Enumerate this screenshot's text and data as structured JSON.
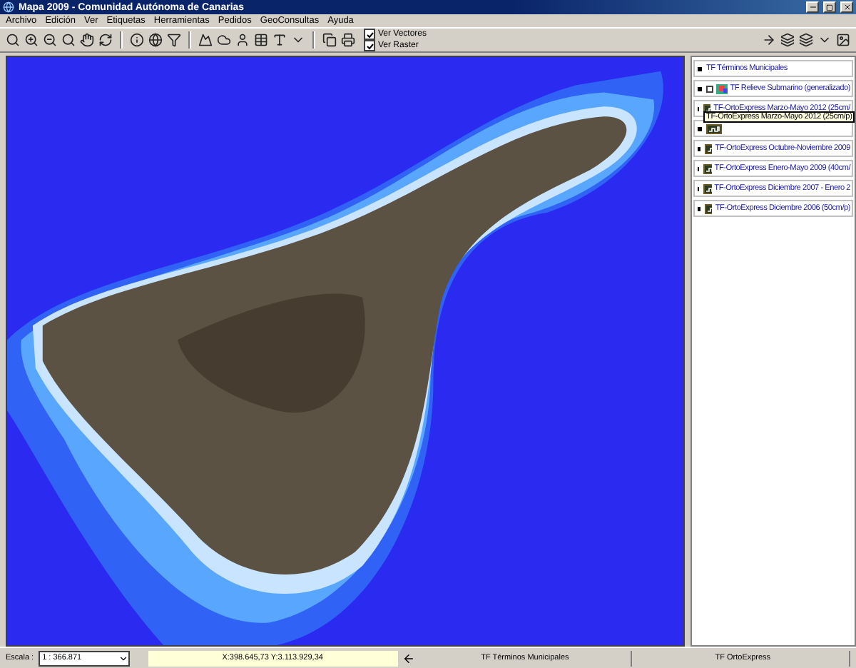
{
  "window": {
    "title": "Mapa 2009 - Comunidad Autónoma de Canarias"
  },
  "menu": [
    {
      "label": "Archivo"
    },
    {
      "label": "Edición"
    },
    {
      "label": "Ver"
    },
    {
      "label": "Etiquetas"
    },
    {
      "label": "Herramientas"
    },
    {
      "label": "Pedidos"
    },
    {
      "label": "GeoConsultas"
    },
    {
      "label": "Ayuda"
    }
  ],
  "toolbar": {
    "checks": [
      {
        "label": "Ver Vectores",
        "checked": true
      },
      {
        "label": "Ver Raster",
        "checked": true
      }
    ]
  },
  "layers": [
    {
      "kind": "vector",
      "label": "TF Términos Municipales"
    },
    {
      "kind": "relief",
      "label": "TF Relieve Submarino (generalizado)"
    },
    {
      "kind": "ortho",
      "label": "TF-OrtoExpress Marzo-Mayo 2012 (25cm/"
    },
    {
      "kind": "ortho"
    },
    {
      "kind": "ortho",
      "label": "TF-OrtoExpress Octubre-Noviembre 2009"
    },
    {
      "kind": "ortho",
      "label": "TF-OrtoExpress Enero-Mayo 2009 (40cm/"
    },
    {
      "kind": "ortho",
      "label": "TF-OrtoExpress Diciembre 2007 - Enero 2"
    },
    {
      "kind": "ortho",
      "label": "TF-OrtoExpress Diciembre 2006 (50cm/p)"
    }
  ],
  "tooltip": {
    "text": "TF-OrtoExpress Marzo-Mayo 2012 (25cm/p)"
  },
  "status_bar": {
    "scale_label": "Escala :",
    "scale_value": "1 : 366.871",
    "coordinates": "X:398.645,73  Y:3.113.929,34",
    "panels": [
      "TF Términos Municipales",
      "TF OrtoExpress"
    ]
  }
}
